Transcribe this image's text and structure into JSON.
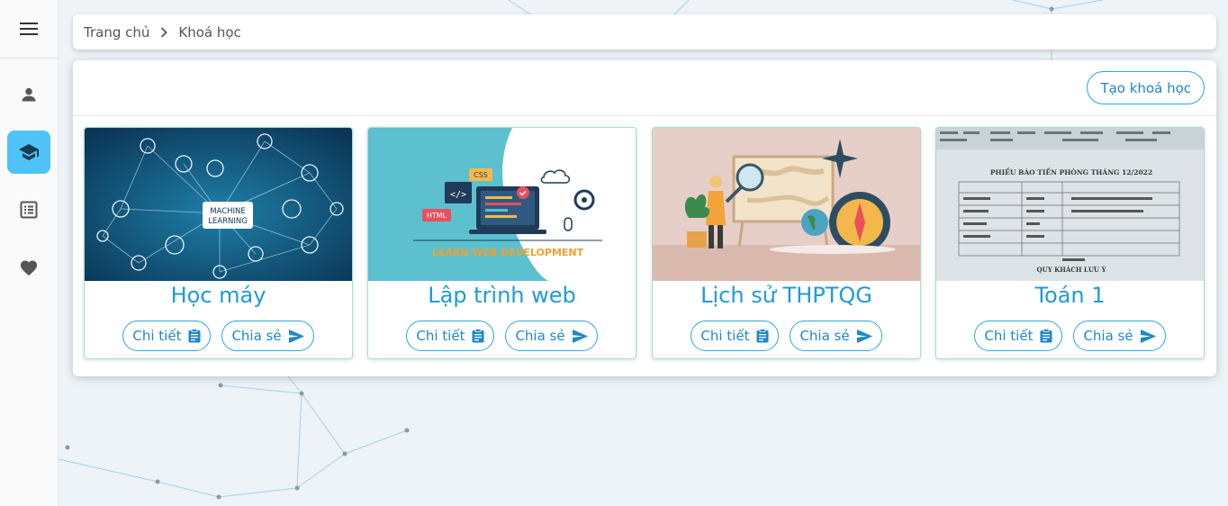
{
  "breadcrumb": {
    "home": "Trang chủ",
    "current": "Khoá học"
  },
  "toolbar": {
    "create_label": "Tạo khoá học"
  },
  "sidebar": {
    "items": [
      {
        "icon": "person-icon"
      },
      {
        "icon": "school-icon",
        "active": true
      },
      {
        "icon": "list-icon"
      },
      {
        "icon": "heart-icon"
      }
    ]
  },
  "courses": [
    {
      "title": "Học máy",
      "thumb_text": "MACHINE LEARNING",
      "detail_label": "Chi tiết",
      "share_label": "Chia sẻ"
    },
    {
      "title": "Lập trình web",
      "thumb_text": "LEARN WEB DEVELOPMENT",
      "thumb_css": "CSS",
      "thumb_html": "HTML",
      "detail_label": "Chi tiết",
      "share_label": "Chia sẻ"
    },
    {
      "title": "Lịch sử THPTQG",
      "detail_label": "Chi tiết",
      "share_label": "Chia sẻ"
    },
    {
      "title": "Toán 1",
      "thumb_heading": "PHIẾU BÁO TIỀN PHÒNG THÁNG 12/2022",
      "thumb_footer": "QUY KHÁCH LƯU Ý",
      "detail_label": "Chi tiết",
      "share_label": "Chia sẻ"
    }
  ],
  "colors": {
    "accent": "#1e9bd7",
    "active_sidebar": "#4fc3f7",
    "card_border": "#a5e0c8"
  }
}
